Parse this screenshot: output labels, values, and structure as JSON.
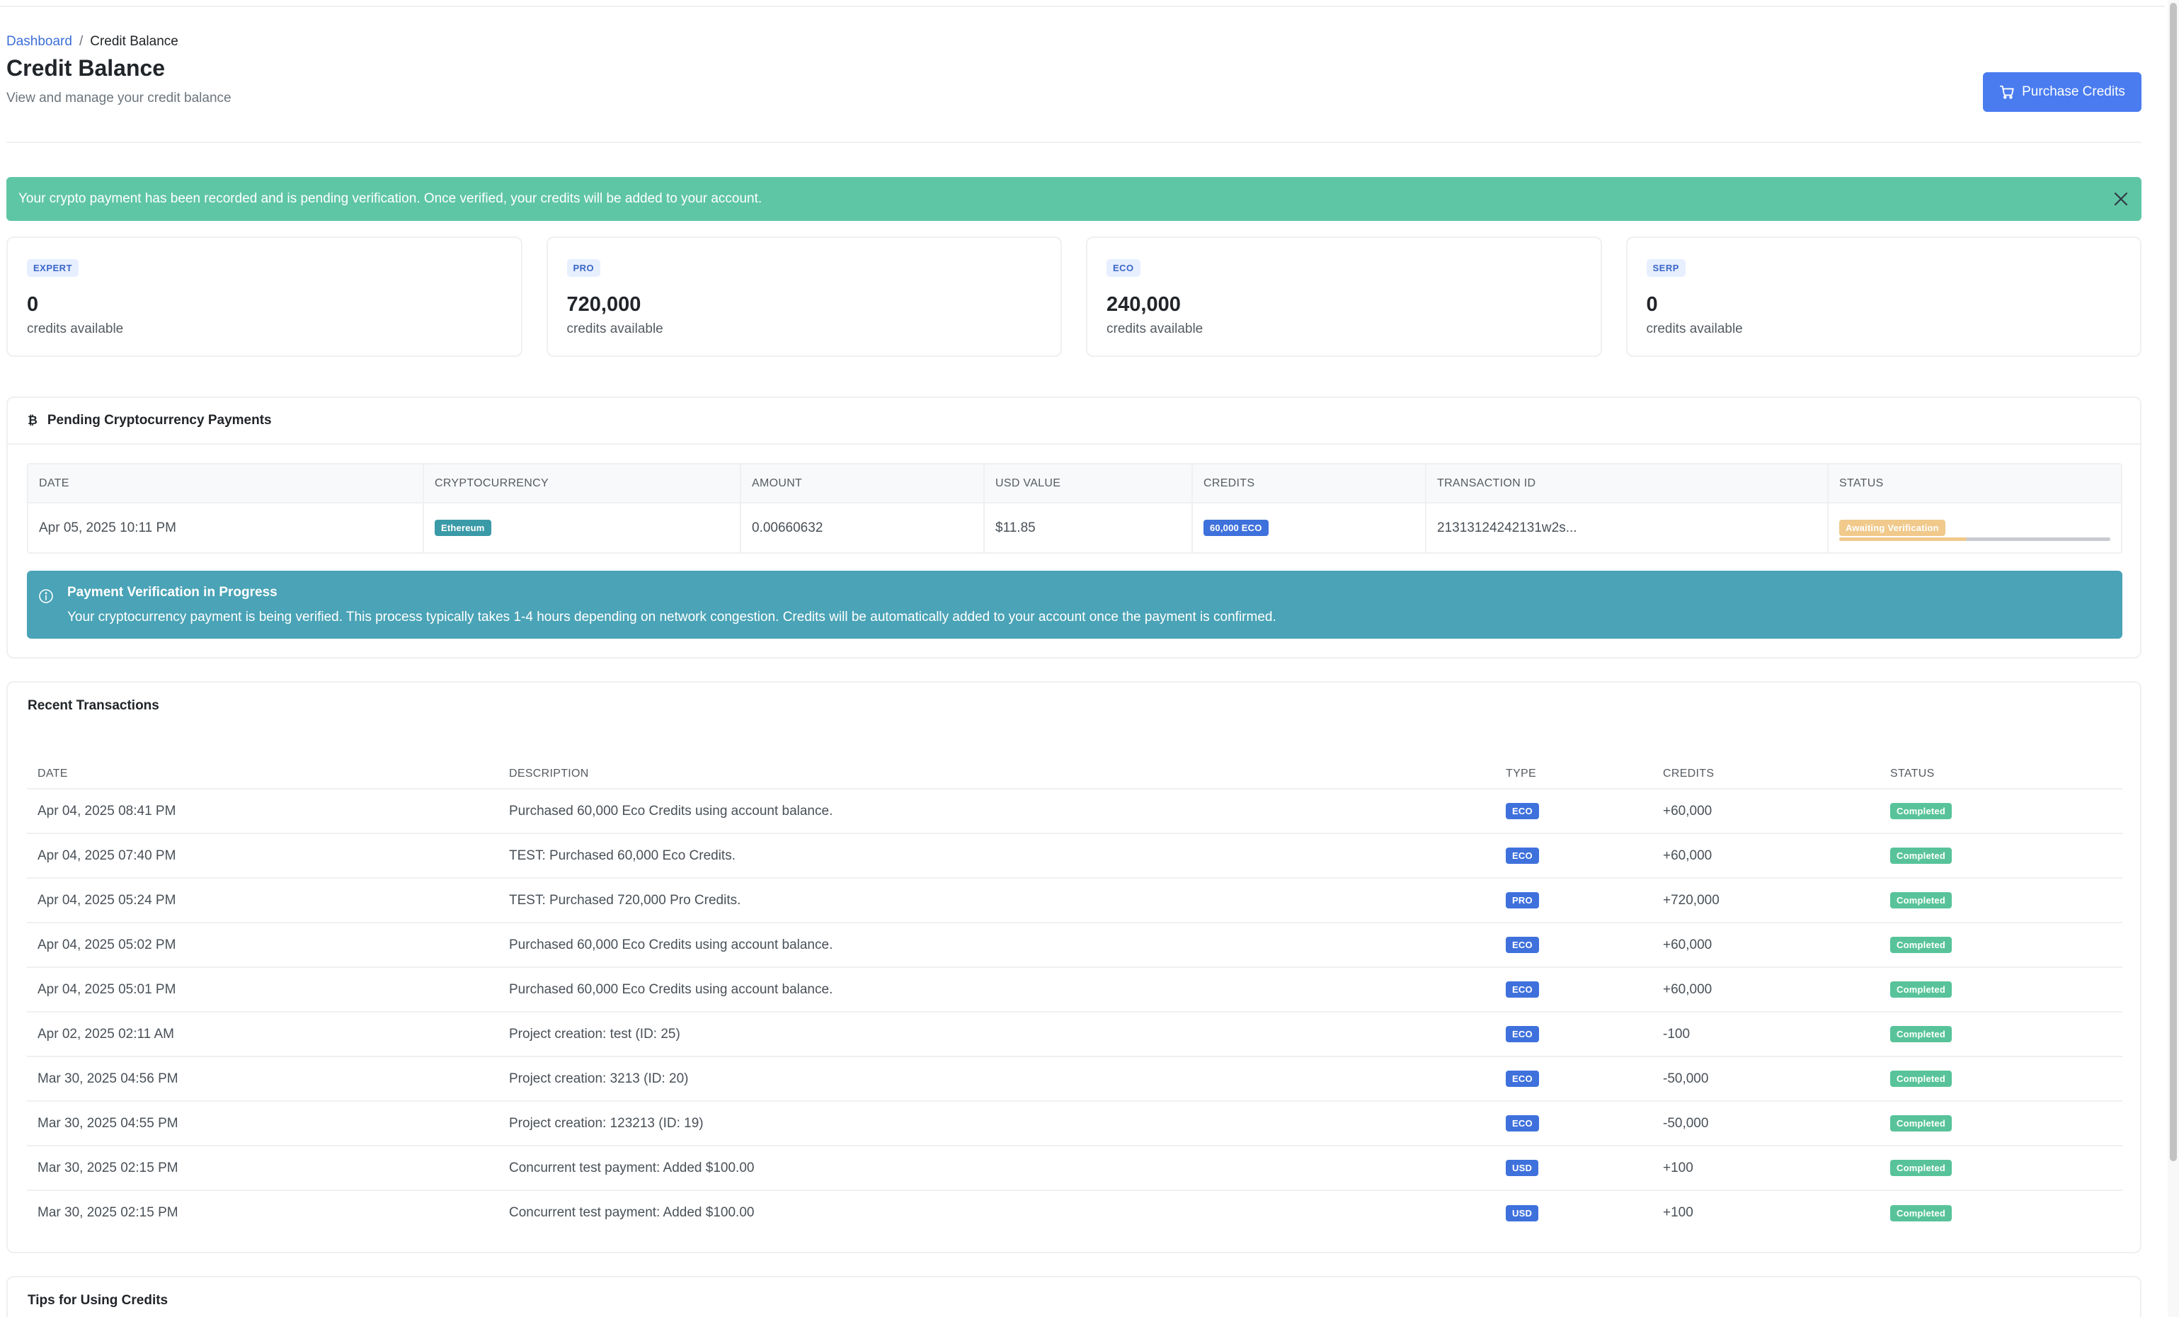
{
  "breadcrumb": {
    "parent": "Dashboard",
    "separator": "/",
    "current": "Credit Balance"
  },
  "header": {
    "title": "Credit Balance",
    "subtitle": "View and manage your credit balance",
    "purchase_label": "Purchase Credits"
  },
  "alert": {
    "message": "Your crypto payment has been recorded and is pending verification. Once verified, your credits will be added to your account."
  },
  "credit_cards": [
    {
      "tier": "EXPERT",
      "amount": "0",
      "label": "credits available"
    },
    {
      "tier": "PRO",
      "amount": "720,000",
      "label": "credits available"
    },
    {
      "tier": "ECO",
      "amount": "240,000",
      "label": "credits available"
    },
    {
      "tier": "SERP",
      "amount": "0",
      "label": "credits available"
    }
  ],
  "pending": {
    "icon": "₿",
    "title": "Pending Cryptocurrency Payments",
    "columns": [
      "DATE",
      "CRYPTOCURRENCY",
      "AMOUNT",
      "USD VALUE",
      "CREDITS",
      "TRANSACTION ID",
      "STATUS"
    ],
    "rows": [
      {
        "date": "Apr 05, 2025 10:11 PM",
        "crypto": "Ethereum",
        "amount": "0.00660632",
        "usd": "$11.85",
        "credits": "60,000 ECO",
        "txid": "21313124242131w2s...",
        "status": "Awaiting Verification",
        "progress": 0.47
      }
    ],
    "info": {
      "title": "Payment Verification in Progress",
      "text": "Your cryptocurrency payment is being verified. This process typically takes 1-4 hours depending on network congestion. Credits will be automatically added to your account once the payment is confirmed."
    }
  },
  "recent": {
    "title": "Recent Transactions",
    "columns": [
      "DATE",
      "DESCRIPTION",
      "TYPE",
      "CREDITS",
      "STATUS"
    ],
    "rows": [
      {
        "date": "Apr 04, 2025 08:41 PM",
        "description": "Purchased 60,000 Eco Credits using account balance.",
        "type": "ECO",
        "credits": "+60,000",
        "status": "Completed"
      },
      {
        "date": "Apr 04, 2025 07:40 PM",
        "description": "TEST: Purchased 60,000 Eco Credits.",
        "type": "ECO",
        "credits": "+60,000",
        "status": "Completed"
      },
      {
        "date": "Apr 04, 2025 05:24 PM",
        "description": "TEST: Purchased 720,000 Pro Credits.",
        "type": "PRO",
        "credits": "+720,000",
        "status": "Completed"
      },
      {
        "date": "Apr 04, 2025 05:02 PM",
        "description": "Purchased 60,000 Eco Credits using account balance.",
        "type": "ECO",
        "credits": "+60,000",
        "status": "Completed"
      },
      {
        "date": "Apr 04, 2025 05:01 PM",
        "description": "Purchased 60,000 Eco Credits using account balance.",
        "type": "ECO",
        "credits": "+60,000",
        "status": "Completed"
      },
      {
        "date": "Apr 02, 2025 02:11 AM",
        "description": "Project creation: test (ID: 25)",
        "type": "ECO",
        "credits": "-100",
        "status": "Completed"
      },
      {
        "date": "Mar 30, 2025 04:56 PM",
        "description": "Project creation: 3213 (ID: 20)",
        "type": "ECO",
        "credits": "-50,000",
        "status": "Completed"
      },
      {
        "date": "Mar 30, 2025 04:55 PM",
        "description": "Project creation: 123213 (ID: 19)",
        "type": "ECO",
        "credits": "-50,000",
        "status": "Completed"
      },
      {
        "date": "Mar 30, 2025 02:15 PM",
        "description": "Concurrent test payment: Added $100.00",
        "type": "USD",
        "credits": "+100",
        "status": "Completed"
      },
      {
        "date": "Mar 30, 2025 02:15 PM",
        "description": "Concurrent test payment: Added $100.00",
        "type": "USD",
        "credits": "+100",
        "status": "Completed"
      }
    ]
  },
  "tips": {
    "title": "Tips for Using Credits"
  },
  "icons": {
    "cart": "cart-icon",
    "close": "close-icon",
    "bitcoin": "bitcoin-icon",
    "info": "info-icon"
  },
  "colors": {
    "primary": "#4a7cf0",
    "success_alert": "#5fc6a5",
    "info_alert": "#4aa3b6",
    "completed": "#58c39a",
    "awaiting": "#f0c98b",
    "type_badge": "#3f71dc",
    "crypto_badge": "#3b9aa8"
  }
}
